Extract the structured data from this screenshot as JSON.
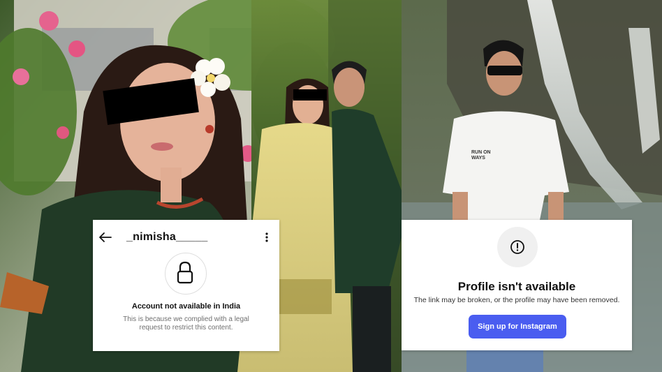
{
  "left_card": {
    "username": "_nimisha_____",
    "title": "Account not available in India",
    "body": "This is because we complied with a legal request to restrict this content.",
    "icons": {
      "back": "arrow-left-icon",
      "more": "more-vertical-icon",
      "lock": "lock-icon"
    }
  },
  "right_card": {
    "title": "Profile isn't available",
    "body": "The link may be broken, or the profile may have been removed.",
    "button_label": "Sign up for Instagram",
    "icons": {
      "alert": "alert-circle-icon"
    }
  },
  "colors": {
    "button_blue": "#4a5df0",
    "censor_bar": "#000000",
    "card_bg": "#ffffff"
  },
  "scene": {
    "description_labels": [
      "woman-with-flower",
      "couple-traditional-attire",
      "man-at-waterfall"
    ],
    "shirt_text": "RUN ON WAYS"
  }
}
